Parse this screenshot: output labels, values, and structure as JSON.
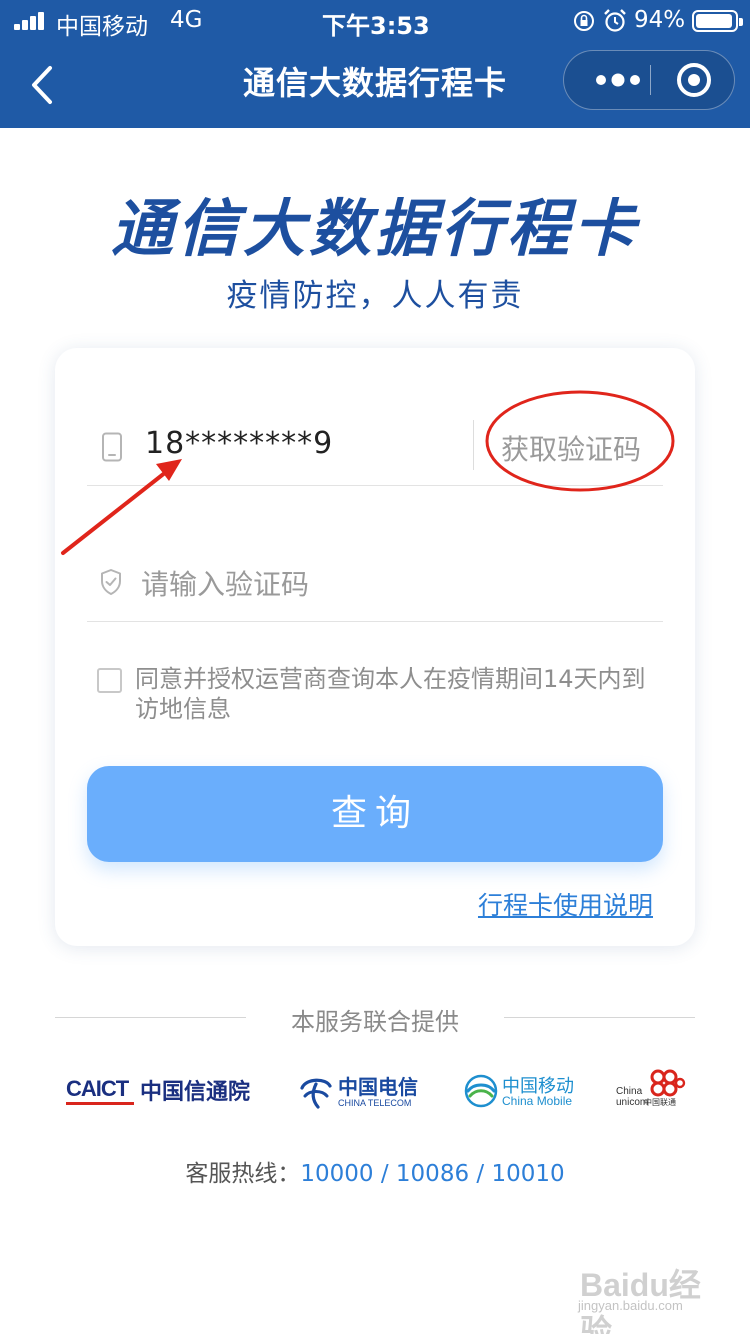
{
  "status_bar": {
    "carrier": "中国移动",
    "network": "4G",
    "time": "下午3:53",
    "battery": "94%",
    "battery_level": 0.94
  },
  "nav": {
    "title": "通信大数据行程卡",
    "back_icon": "chevron-left-icon",
    "more_icon": "more-dots-icon",
    "close_icon": "target-circle-icon"
  },
  "hero": {
    "title": "通信大数据行程卡",
    "subtitle": "疫情防控，人人有责"
  },
  "form": {
    "phone_value": "18********9",
    "get_code_label": "获取验证码",
    "code_placeholder": "请输入验证码",
    "agree_text": "同意并授权运营商查询本人在疫情期间14天内到访地信息",
    "agree_checked": false,
    "query_label": "查询",
    "guide_link": "行程卡使用说明"
  },
  "footer": {
    "provided_by": "本服务联合提供",
    "logos": {
      "caict_mark": "CAICT",
      "caict_name": "中国信通院",
      "telecom_name": "中国电信",
      "telecom_en": "CHINA TELECOM",
      "mobile_name": "中国移动",
      "mobile_en": "China Mobile",
      "unicom_en": "China unicom",
      "unicom_cn": "中国联通"
    },
    "hotline_label": "客服热线：",
    "hotline_numbers": "10000 / 10086 / 10010"
  },
  "watermark": {
    "text": "Baidu经验",
    "sub": "jingyan.baidu.com"
  },
  "colors": {
    "header": "#1f5aa6",
    "title_blue": "#1d4f9f",
    "button_blue": "#6aaefc",
    "link_blue": "#2d7fd8",
    "annotation_red": "#e0251b"
  }
}
